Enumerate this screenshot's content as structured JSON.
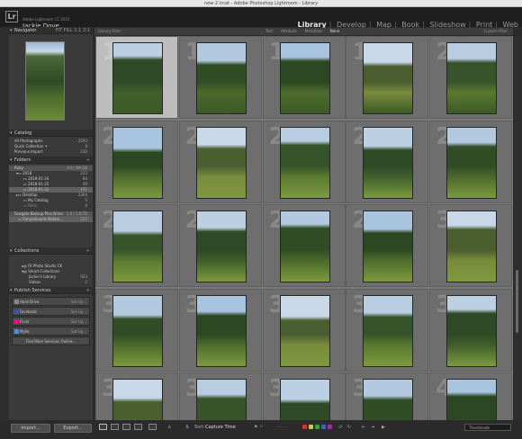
{
  "window": {
    "title": "new-2.lrcat - Adobe Photoshop Lightroom - Library"
  },
  "identity": {
    "logo": "Lr",
    "subtitle": "Adobe Lightroom CC 2015",
    "user": "Jackie Dove"
  },
  "modules": [
    "Library",
    "Develop",
    "Map",
    "Book",
    "Slideshow",
    "Print",
    "Web"
  ],
  "navigator": {
    "title": "Navigator",
    "zoom": "FIT  FILL  1:1  3:1"
  },
  "catalog": {
    "title": "Catalog",
    "items": [
      {
        "label": "All Photographs",
        "count": "2593"
      },
      {
        "label": "Quick Collection +",
        "count": "0"
      },
      {
        "label": "Previous Import",
        "count": "230"
      }
    ]
  },
  "folders": {
    "title": "Folders",
    "volume": "Ruby",
    "volume_info": "4.6 / 6A GB",
    "items": [
      {
        "label": "2018",
        "count": "233"
      },
      {
        "label": "2018-01-24",
        "count": "84"
      },
      {
        "label": "2018-01-25",
        "count": "49"
      },
      {
        "label": "2018-01-31",
        "count": "162"
      },
      {
        "label": "Desktop",
        "count": "2304"
      },
      {
        "label": "My Catalog",
        "count": "5"
      },
      {
        "label": "Parts",
        "count": "0"
      }
    ],
    "drive": "Seagate Backup Plus Drive",
    "drive_info": "1.0 / 1.8 TB",
    "drive_folder": "CanyonLands Nation...",
    "drive_count": "222"
  },
  "collections": {
    "title": "Collections",
    "items": [
      {
        "label": "Fit Photo Studio CK",
        "count": ""
      },
      {
        "label": "Smart Collections",
        "count": ""
      },
      {
        "label": "Jackie's Library",
        "count": "923"
      },
      {
        "label": "Videos",
        "count": "2"
      }
    ]
  },
  "publish": {
    "title": "Publish Services",
    "items": [
      {
        "label": "Hard Drive",
        "action": "Set Up..."
      },
      {
        "label": "Facebook",
        "action": "Set Up..."
      },
      {
        "label": "Flickr",
        "action": "Set Up..."
      },
      {
        "label": "Mylio",
        "action": "Set Up..."
      }
    ],
    "find_more": "Find More Services Online..."
  },
  "buttons": {
    "import": "Import...",
    "export": "Export..."
  },
  "filter": {
    "title": "Library Filter :",
    "options": [
      "Text",
      "Attribute",
      "Metadata",
      "None"
    ],
    "active": "None",
    "filters_off": "Custom Filter"
  },
  "toolbar": {
    "sort_label": "Sort:",
    "sort_value": "Capture Time",
    "thumbnails": "Thumbnails"
  },
  "grid": {
    "numbers": [
      "16",
      "17",
      "18",
      "19",
      "20",
      "21",
      "22",
      "23",
      "24",
      "25",
      "26",
      "27",
      "28",
      "29",
      "30",
      "31",
      "32",
      "33",
      "34",
      "35",
      "36",
      "37",
      "38",
      "39",
      "40"
    ]
  }
}
